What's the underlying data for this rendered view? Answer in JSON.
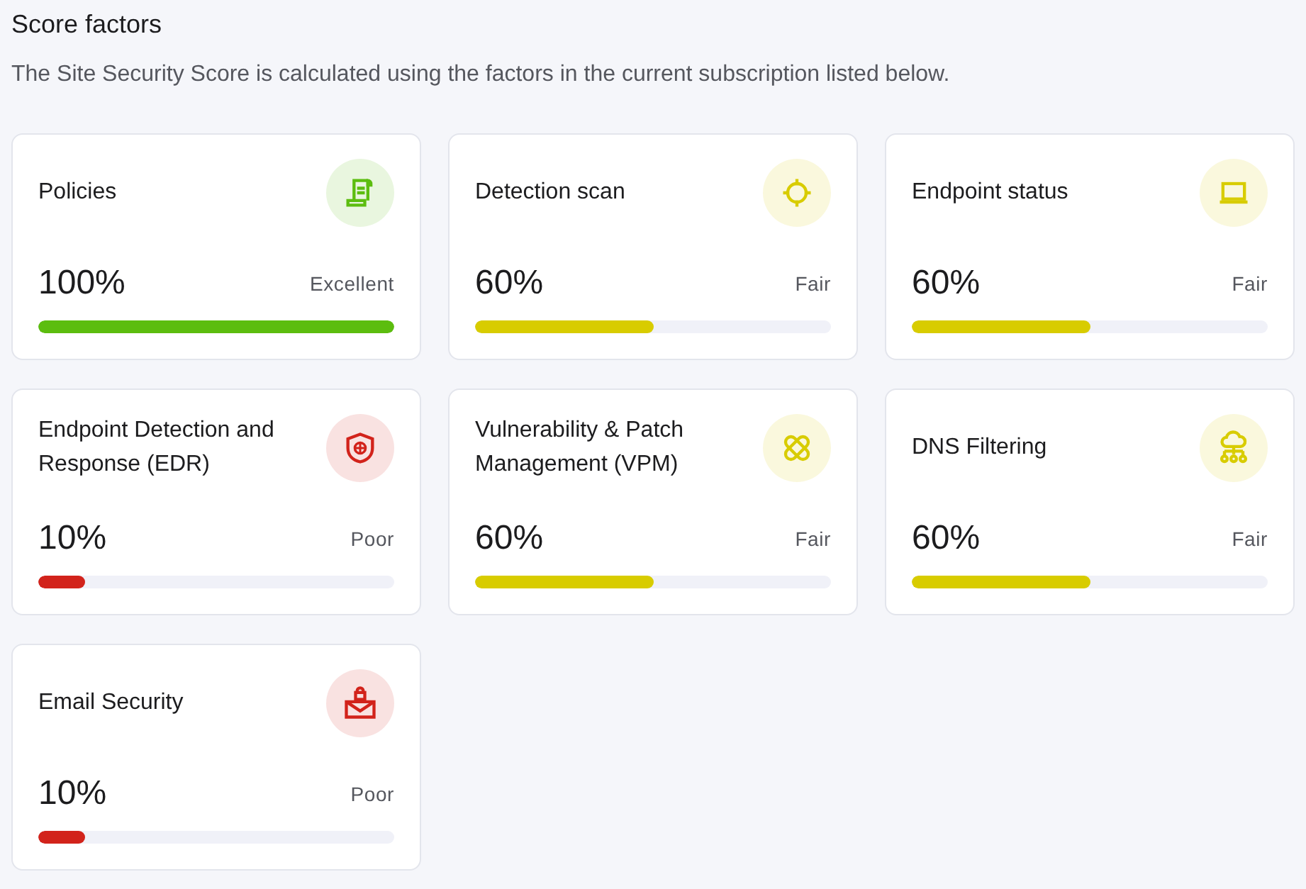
{
  "header": {
    "title": "Score factors",
    "description": "The Site Security Score is calculated using the factors in the current subscription listed below."
  },
  "factors": [
    {
      "kind": "policies",
      "name": "Policies",
      "percent": "100%",
      "rating": "Excellent",
      "level": 1,
      "color": "#5cbd0f"
    },
    {
      "kind": "scan",
      "name": "Detection scan",
      "percent": "60%",
      "rating": "Fair",
      "level": 0.5,
      "color": "#d8cc00"
    },
    {
      "kind": "endpoint",
      "name": "Endpoint status",
      "percent": "60%",
      "rating": "Fair",
      "level": 0.5,
      "color": "#d8cc00"
    },
    {
      "kind": "edr",
      "name": "Endpoint Detection and Response (EDR)",
      "percent": "10%",
      "rating": "Poor",
      "level": 0.13,
      "color": "#d2231b"
    },
    {
      "kind": "vpm",
      "name": "Vulnerability & Patch Management (VPM)",
      "percent": "60%",
      "rating": "Fair",
      "level": 0.5,
      "color": "#d8cc00"
    },
    {
      "kind": "dns",
      "name": "DNS Filtering",
      "percent": "60%",
      "rating": "Fair",
      "level": 0.5,
      "color": "#d8cc00"
    },
    {
      "kind": "email",
      "name": "Email Security",
      "percent": "10%",
      "rating": "Poor",
      "level": 0.13,
      "color": "#d2231b"
    }
  ]
}
